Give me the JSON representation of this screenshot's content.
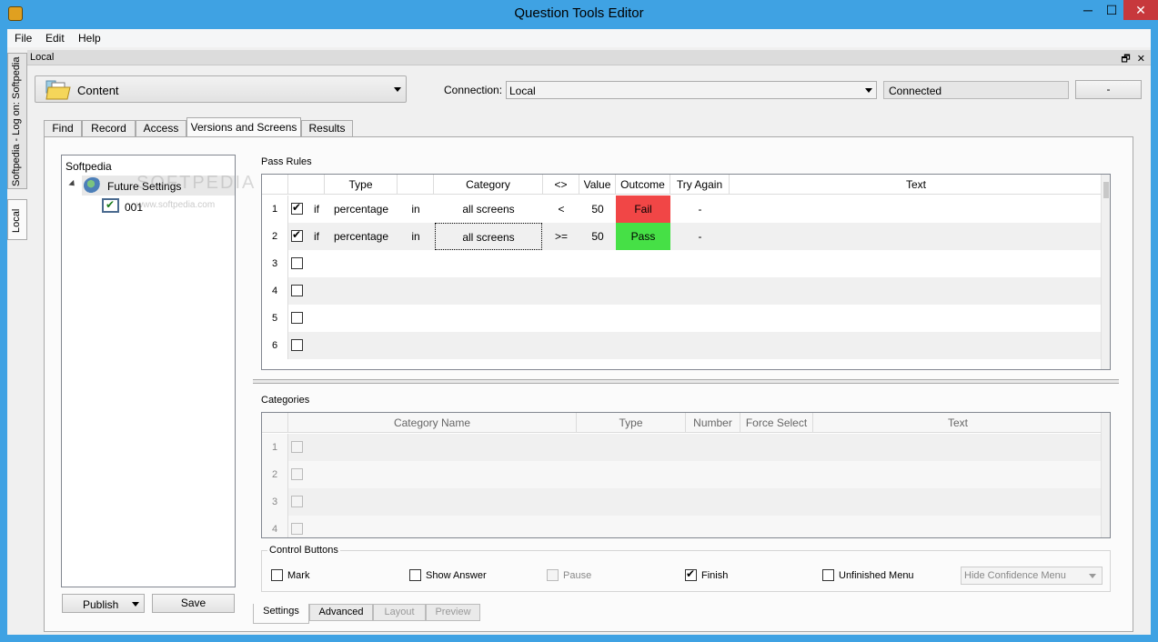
{
  "window": {
    "title": "Question Tools Editor",
    "min_label": "─",
    "max_label": "☐",
    "close_label": "✕"
  },
  "menu": [
    "File",
    "Edit",
    "Help"
  ],
  "side_tabs": [
    "Softpedia - Log on: Softpedia",
    "Local"
  ],
  "local_header": {
    "label": "Local",
    "restore_icon": "🗗",
    "close_icon": "✕"
  },
  "content_combo": {
    "value": "Content"
  },
  "connection": {
    "label": "Connection:",
    "value": "Local",
    "status": "Connected",
    "button": "-"
  },
  "tabs": [
    "Find",
    "Record",
    "Access",
    "Versions and Screens",
    "Results"
  ],
  "active_tab": "Versions and Screens",
  "tree": {
    "root": "Softpedia",
    "node": "Future Settings",
    "child": "001",
    "watermark": "SOFTPEDIA",
    "watermark_url": "www.softpedia.com"
  },
  "left_buttons": {
    "publish": "Publish",
    "save": "Save"
  },
  "pass_rules": {
    "title": "Pass Rules",
    "columns": [
      "Type",
      "Category",
      "<>",
      "Value",
      "Outcome",
      "Try Again",
      "Text"
    ],
    "rows": [
      {
        "num": "1",
        "checked": true,
        "if": "if",
        "type": "percentage",
        "in": "in",
        "category": "all screens",
        "op": "<",
        "value": "50",
        "outcome": "Fail",
        "try_again": "-"
      },
      {
        "num": "2",
        "checked": true,
        "if": "if",
        "type": "percentage",
        "in": "in",
        "category": "all screens",
        "op": ">=",
        "value": "50",
        "outcome": "Pass",
        "try_again": "-"
      },
      {
        "num": "3",
        "checked": false
      },
      {
        "num": "4",
        "checked": false
      },
      {
        "num": "5",
        "checked": false
      },
      {
        "num": "6",
        "checked": false
      }
    ],
    "outcome_colors": {
      "fail": "#f14646",
      "pass": "#46e046"
    }
  },
  "categories": {
    "title": "Categories",
    "columns": [
      "Category Name",
      "Type",
      "Number",
      "Force Select",
      "Text"
    ],
    "rows": [
      "1",
      "2",
      "3",
      "4"
    ]
  },
  "control_buttons": {
    "title": "Control Buttons",
    "items": [
      {
        "label": "Mark",
        "checked": false,
        "disabled": false
      },
      {
        "label": "Show Answer",
        "checked": false,
        "disabled": false
      },
      {
        "label": "Pause",
        "checked": false,
        "disabled": true
      },
      {
        "label": "Finish",
        "checked": true,
        "disabled": false
      },
      {
        "label": "Unfinished Menu",
        "checked": false,
        "disabled": false
      }
    ],
    "confidence_menu": "Hide Confidence Menu"
  },
  "bottom_tabs": [
    "Settings",
    "Advanced",
    "Layout",
    "Preview"
  ]
}
